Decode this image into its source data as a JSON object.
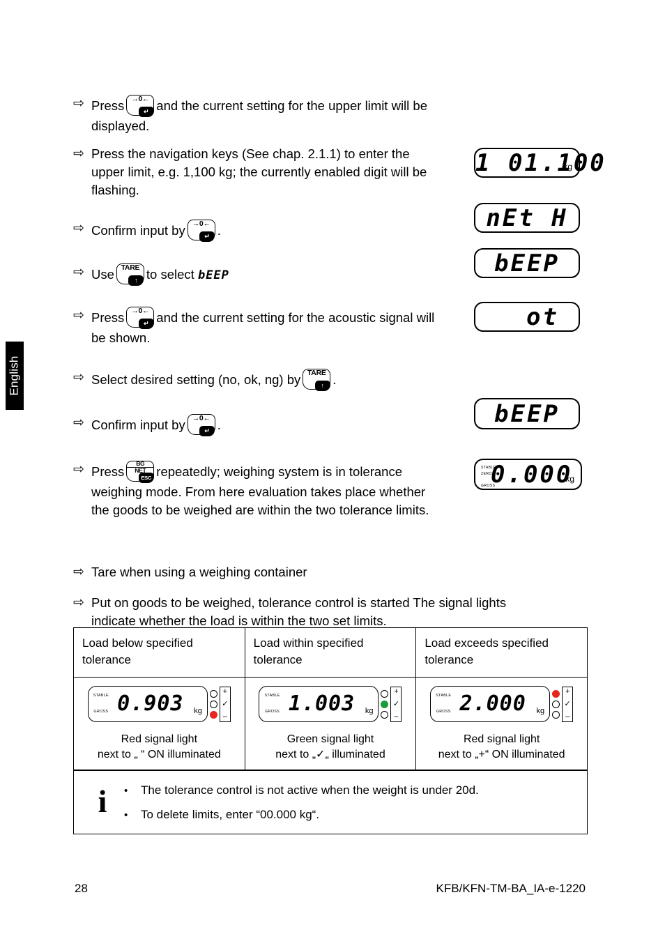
{
  "sidebar": {
    "language_tab": "English"
  },
  "steps": [
    {
      "id": "step-upper-limit-display",
      "bullet": "⇨",
      "pre": "Press",
      "key": {
        "name": "zero-enter-key",
        "label": "→0←",
        "badge": "↵"
      },
      "post_lines": [
        "and the current setting for the upper limit will be",
        "displayed."
      ]
    },
    {
      "id": "step-enter-upper-limit",
      "bullet": "⇨",
      "pre": "",
      "key": null,
      "post_lines": [
        "Press the navigation keys (See chap. 2.1.1) to enter the",
        "upper limit, e.g. 1,100 kg; the currently enabled digit will be",
        "flashing."
      ]
    },
    {
      "id": "step-confirm-upper-limit",
      "bullet": "⇨",
      "pre": "Confirm input by",
      "key": {
        "name": "zero-enter-key",
        "label": "→0←",
        "badge": "↵"
      },
      "post_lines": [
        "."
      ]
    },
    {
      "id": "step-select-beep",
      "bullet": "⇨",
      "pre": "Use",
      "key": {
        "name": "tare-key",
        "label": "TARE",
        "badge": "↑"
      },
      "post_lines": [
        "to select"
      ],
      "seg_suffix": "bEEP"
    },
    {
      "id": "step-show-acoustic-signal",
      "bullet": "⇨",
      "pre": "Press",
      "key": {
        "name": "zero-enter-key",
        "label": "→0←",
        "badge": "↵"
      },
      "post_lines": [
        "and the current setting for the acoustic signal will",
        "be shown."
      ]
    },
    {
      "id": "step-select-desired-setting",
      "bullet": "⇨",
      "pre": "Select desired setting (no, ok, ng) by",
      "key": {
        "name": "tare-key",
        "label": "TARE",
        "badge": "↑"
      },
      "post_lines": [
        "."
      ]
    },
    {
      "id": "step-confirm-beep",
      "bullet": "⇨",
      "pre": "Confirm input by",
      "key": {
        "name": "zero-enter-key",
        "label": "→0←",
        "badge": "↵"
      },
      "post_lines": [
        "."
      ]
    },
    {
      "id": "step-exit-to-tolerance-mode",
      "bullet": "⇨",
      "pre": "Press",
      "key": {
        "name": "bg-net-esc-key",
        "label_top": "BG",
        "label_bottom": "NET",
        "badge": "ESC"
      },
      "post_lines": [
        "repeatedly; weighing system is in tolerance",
        "weighing mode. From here evaluation takes place whether",
        "the goods to be weighed are within the two tolerance limits."
      ]
    },
    {
      "id": "step-tare-container",
      "bullet": "⇨",
      "pre": "",
      "key": null,
      "post_lines": [
        "Tare when using a weighing container"
      ]
    },
    {
      "id": "step-put-goods",
      "bullet": "⇨",
      "pre": "",
      "key": null,
      "post_lines": [
        "Put on goods to be weighed, tolerance control is started The signal lights",
        "indicate whether the load is within the two set limits."
      ]
    }
  ],
  "displays": [
    {
      "id": "display-upper-limit",
      "value": "1 01.100",
      "unit": "kg",
      "align": "right"
    },
    {
      "id": "display-net-h",
      "value": "nEt H",
      "unit": "",
      "align": "center"
    },
    {
      "id": "display-beep-menu",
      "value": "bEEP",
      "unit": "",
      "align": "center"
    },
    {
      "id": "display-ok-setting",
      "value": "ot",
      "unit": "",
      "align": "right"
    },
    {
      "id": "display-beep-confirm",
      "value": "bEEP",
      "unit": "",
      "align": "center"
    },
    {
      "id": "display-zero-weight",
      "value": "0.000",
      "unit": "kg",
      "align": "center",
      "flags": [
        "STABLE",
        "ZERO",
        "GROSS"
      ]
    }
  ],
  "tolerance_table": {
    "headers": [
      "Load below specified tolerance",
      "Load within specified tolerance",
      "Load exceeds specified tolerance"
    ],
    "cells": [
      {
        "id": "tolerance-below",
        "weight": "0.903",
        "unit": "kg",
        "flags": [
          "STABLE",
          "GROSS"
        ],
        "lamps": [
          "off",
          "off",
          "red"
        ],
        "symbols": [
          "+",
          "✓",
          "–"
        ],
        "caption_lines": [
          "Red signal light",
          "next to „ “ ON illuminated"
        ]
      },
      {
        "id": "tolerance-within",
        "weight": "1.003",
        "unit": "kg",
        "flags": [
          "STABLE",
          "GROSS"
        ],
        "lamps": [
          "off",
          "green",
          "off"
        ],
        "symbols": [
          "+",
          "✓",
          "–"
        ],
        "caption_lines": [
          "Green signal light",
          "next to „✓„ illuminated"
        ]
      },
      {
        "id": "tolerance-exceeds",
        "weight": "2.000",
        "unit": "kg",
        "flags": [
          "STABLE",
          "GROSS"
        ],
        "lamps": [
          "red",
          "off",
          "off"
        ],
        "symbols": [
          "+",
          "✓",
          "–"
        ],
        "caption_lines": [
          "Red signal light",
          "next to „+“ ON illuminated"
        ]
      }
    ]
  },
  "note": {
    "icon": "i",
    "bullet": "•",
    "items": [
      "The tolerance control is not active when the weight is under 20d.",
      "To delete limits, enter “00.000 kg“."
    ]
  },
  "footer": {
    "page_number": "28",
    "document_code": "KFB/KFN-TM-BA_IA-e-1220"
  },
  "colors": {
    "red_lamp": "#e8251f",
    "green_lamp": "#1a9c3c"
  }
}
